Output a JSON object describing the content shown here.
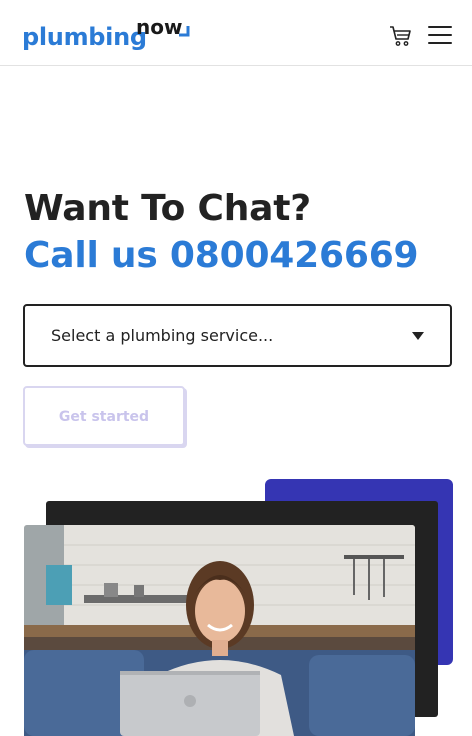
{
  "header": {
    "logo_main": "plumbing",
    "logo_accent": "now",
    "cart_icon": "shopping-cart-icon",
    "menu_icon": "hamburger-menu-icon"
  },
  "hero": {
    "title": "Want To Chat?",
    "phone_line": "Call us 0800426669"
  },
  "service_select": {
    "selected": "Select a plumbing service..."
  },
  "cta": {
    "label": "Get started"
  },
  "image": {
    "subject": "woman-with-laptop-on-sofa"
  },
  "colors": {
    "brand_blue": "#2b7bd6",
    "deco_blue": "#3535b3",
    "deco_dark": "#222222",
    "disabled_button": "#c9c4ec"
  }
}
